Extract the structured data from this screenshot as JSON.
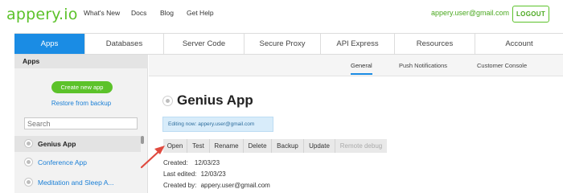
{
  "header": {
    "logo": "appery.io",
    "nav": [
      "What's New",
      "Docs",
      "Blog",
      "Get Help"
    ],
    "user_email": "appery.user@gmail.com",
    "logout_label": "LOGOUT"
  },
  "tabs": [
    "Apps",
    "Databases",
    "Server Code",
    "Secure Proxy",
    "API Express",
    "Resources",
    "Account"
  ],
  "sidebar": {
    "title": "Apps",
    "create_label": "Create new app",
    "restore_label": "Restore from backup",
    "search_placeholder": "Search",
    "apps": [
      "Genius App",
      "Conference App",
      "Meditation and Sleep A..."
    ]
  },
  "subtabs": [
    "General",
    "Push Notifications",
    "Customer Console"
  ],
  "content": {
    "app_name": "Genius App",
    "editing_now": "Editing now: appery.user@gmail.com",
    "actions": [
      "Open",
      "Test",
      "Rename",
      "Delete",
      "Backup",
      "Update",
      "Remote debug"
    ],
    "created_label": "Created:",
    "created_value": "12/03/23",
    "edited_label": "Last edited:",
    "edited_value": "12/03/23",
    "created_by_label": "Created by:",
    "created_by_value": "appery.user@gmail.com"
  },
  "colors": {
    "brand_green": "#5cc22a",
    "accent_blue": "#1a8ce4",
    "annotation_red": "#e04a3f"
  }
}
